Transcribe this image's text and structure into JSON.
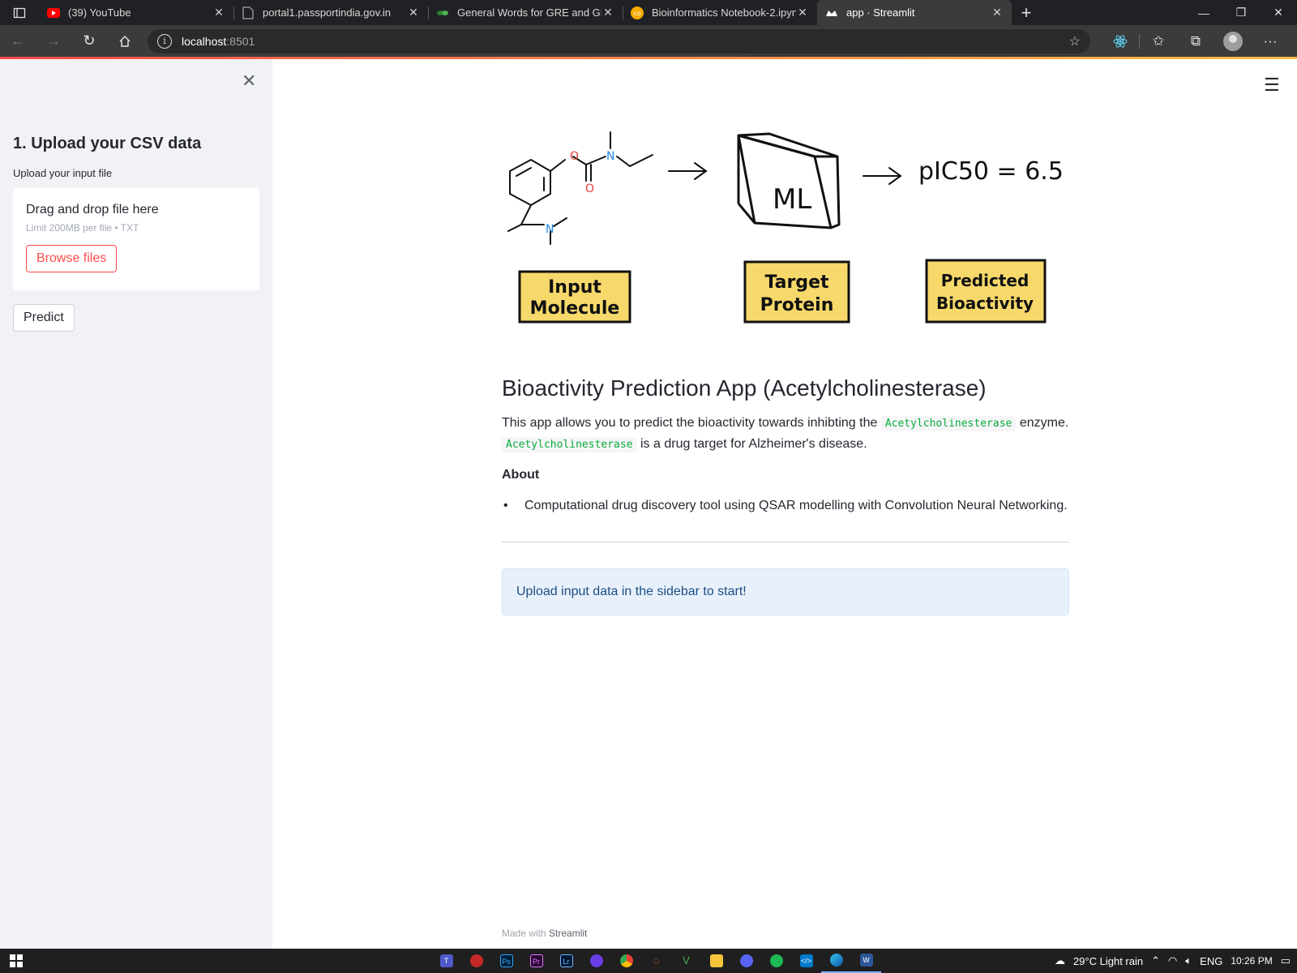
{
  "browser": {
    "tabs": [
      {
        "title": "(39) YouTube",
        "icon": "youtube-icon",
        "active": false
      },
      {
        "title": "portal1.passportindia.gov.in",
        "icon": "document-icon",
        "active": false
      },
      {
        "title": "General Words for GRE and GMA",
        "icon": "sheet-icon",
        "active": false
      },
      {
        "title": "Bioinformatics Notebook-2.ipynb",
        "icon": "colab-icon",
        "active": false
      },
      {
        "title": "app · Streamlit",
        "icon": "streamlit-icon",
        "active": true
      }
    ],
    "address": {
      "host": "localhost",
      "port": ":8501"
    }
  },
  "sidebar": {
    "heading": "1. Upload your CSV data",
    "upload_label": "Upload your input file",
    "dropzone_title": "Drag and drop file here",
    "dropzone_limit": "Limit 200MB per file • TXT",
    "browse_label": "Browse files",
    "predict_label": "Predict"
  },
  "diagram": {
    "boxes": [
      "ML"
    ],
    "formula": "pIC50 = 6.5",
    "labels": [
      {
        "line1": "Input",
        "line2": "Molecule"
      },
      {
        "line1": "Target",
        "line2": "Protein"
      },
      {
        "line1": "Predicted",
        "line2": "Bioactivity"
      }
    ]
  },
  "main": {
    "title": "Bioactivity Prediction App (Acetylcholinesterase)",
    "desc_part1": "This app allows you to predict the bioactivity towards inhibting the",
    "desc_code1": "Acetylcholinesterase",
    "desc_part2": "enzyme.",
    "desc_code2": "Acetylcholinesterase",
    "desc_part3": "is a drug target for Alzheimer's disease.",
    "about_title": "About",
    "bullets": [
      "Computational drug discovery tool using QSAR modelling with Convolution Neural Networking."
    ],
    "alert": "Upload input data in the sidebar to start!",
    "footer_prefix": "Made with",
    "footer_brand": "Streamlit"
  },
  "taskbar": {
    "weather": "29°C  Light rain",
    "lang": "ENG",
    "time": "10:26 PM"
  },
  "colors": {
    "accent": "#ff4b4b",
    "code_green": "#09ab3b",
    "label_yellow": "#f7d96b",
    "alert_bg": "#e8f1fb"
  }
}
